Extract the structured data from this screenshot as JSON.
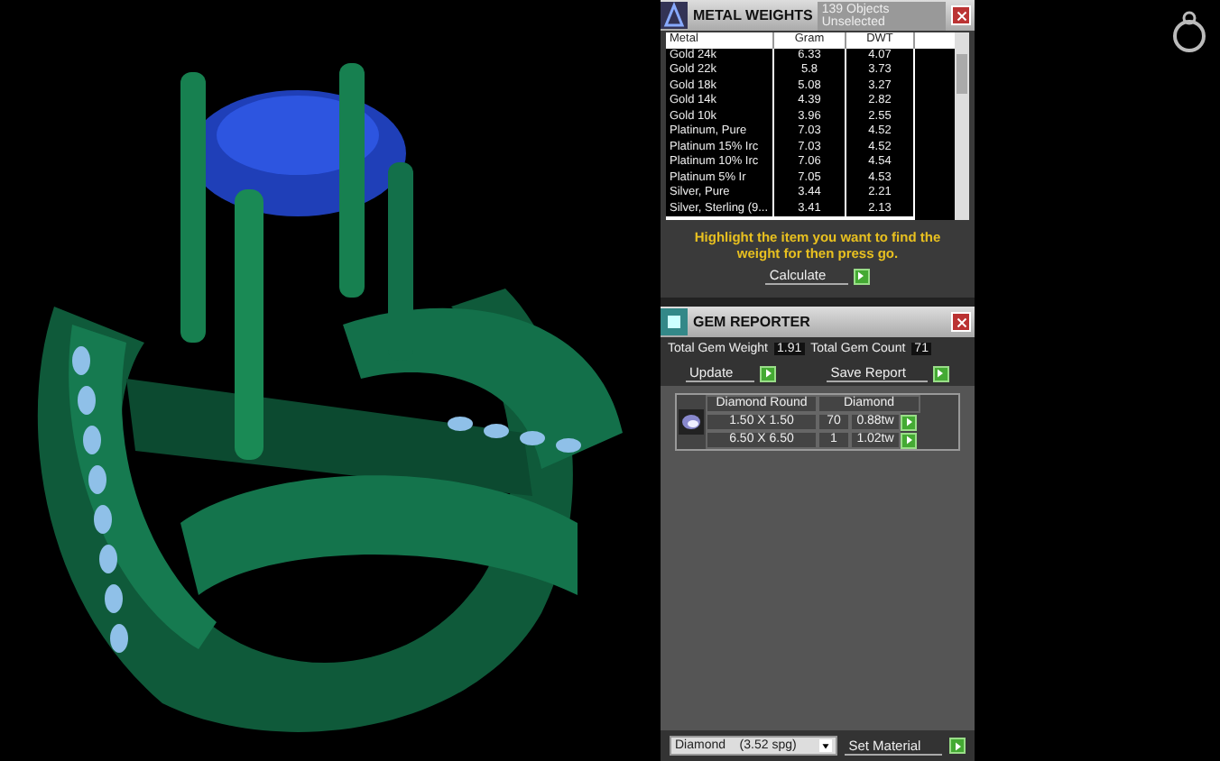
{
  "metal_weights": {
    "title": "METAL WEIGHTS",
    "subtitle": "139 Objects Unselected",
    "columns": [
      "Metal",
      "Gram",
      "DWT"
    ],
    "rows": [
      {
        "metal": "Gold 24k",
        "gram": "6.33",
        "dwt": "4.07"
      },
      {
        "metal": "Gold 22k",
        "gram": "5.8",
        "dwt": "3.73"
      },
      {
        "metal": "Gold 18k",
        "gram": "5.08",
        "dwt": "3.27"
      },
      {
        "metal": "Gold 14k",
        "gram": "4.39",
        "dwt": "2.82"
      },
      {
        "metal": "Gold 10k",
        "gram": "3.96",
        "dwt": "2.55"
      },
      {
        "metal": "Platinum, Pure",
        "gram": "7.03",
        "dwt": "4.52"
      },
      {
        "metal": "Platinum 15% Irc",
        "gram": "7.03",
        "dwt": "4.52"
      },
      {
        "metal": "Platinum 10% Irc",
        "gram": "7.06",
        "dwt": "4.54"
      },
      {
        "metal": "Platinum 5% Ir",
        "gram": "7.05",
        "dwt": "4.53"
      },
      {
        "metal": "Silver, Pure",
        "gram": "3.44",
        "dwt": "2.21"
      },
      {
        "metal": "Silver, Sterling (9...",
        "gram": "3.41",
        "dwt": "2.13"
      }
    ],
    "hint": "Highlight the item you want to find the weight for then press go.",
    "calculate_label": "Calculate"
  },
  "gem_reporter": {
    "title": "GEM REPORTER",
    "total_weight_label": "Total Gem Weight",
    "total_weight": "1.91",
    "total_count_label": "Total Gem Count",
    "total_count": "71",
    "update_label": "Update",
    "save_report_label": "Save Report",
    "group": {
      "shape": "Diamond Round",
      "material": "Diamond",
      "rows": [
        {
          "size": "1.50 X 1.50",
          "count": "70",
          "weight": "0.88tw"
        },
        {
          "size": "6.50 X 6.50",
          "count": "1",
          "weight": "1.02tw"
        }
      ]
    },
    "material_select": "Diamond    (3.52 spg)",
    "set_material_label": "Set Material"
  }
}
